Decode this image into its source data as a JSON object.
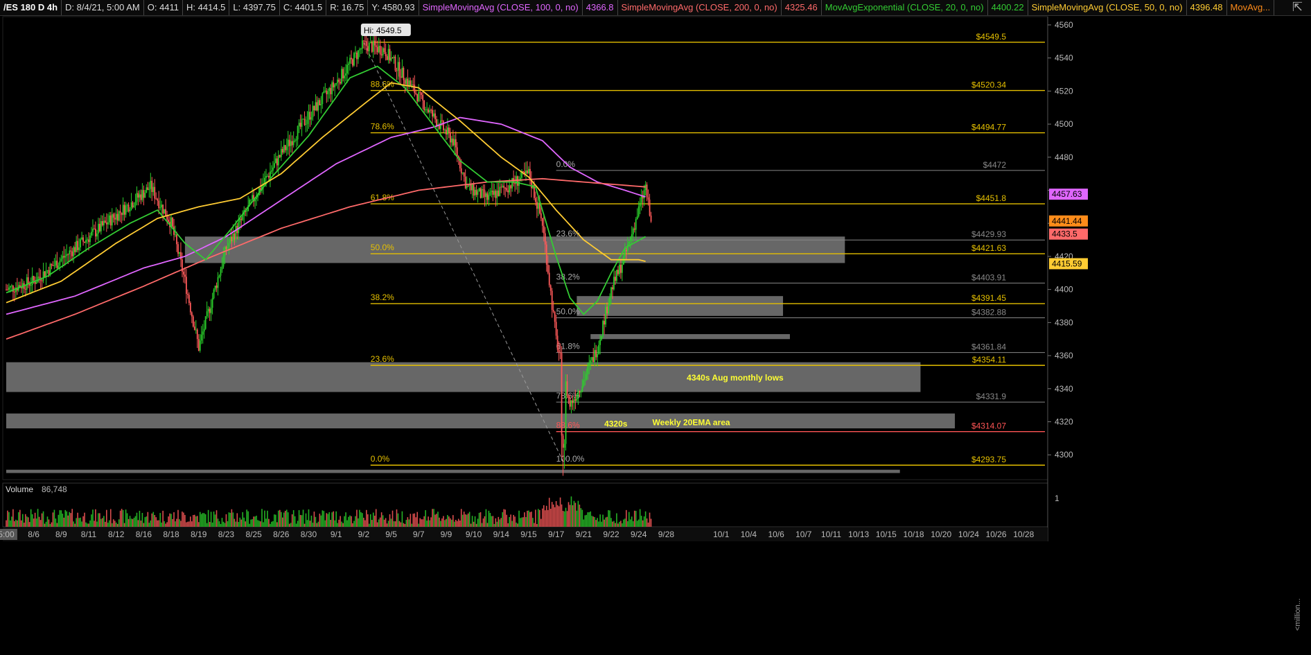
{
  "header": {
    "symbol": "/ES 180 D 4h",
    "date": "D: 8/4/21, 5:00 AM",
    "open": "O: 4411",
    "high": "H: 4414.5",
    "low": "L: 4397.75",
    "close": "C: 4401.5",
    "range": "R: 16.75",
    "y": "Y: 4580.93",
    "studies": [
      {
        "label": "SimpleMovingAvg (CLOSE, 100, 0, no)",
        "value": "4366.8",
        "color": "#e066ff"
      },
      {
        "label": "SimpleMovingAvg (CLOSE, 200, 0, no)",
        "value": "4325.46",
        "color": "#ff6a6a"
      },
      {
        "label": "MovAvgExponential (CLOSE, 20, 0, no)",
        "value": "4400.22",
        "color": "#33cc33"
      },
      {
        "label": "SimpleMovingAvg (CLOSE, 50, 0, no)",
        "value": "4396.48",
        "color": "#ffcc33"
      },
      {
        "label": "MovAvg...",
        "value": "",
        "color": "#ff8c1a"
      }
    ]
  },
  "chart_data": {
    "type": "line",
    "title": "/ES 180 D 4h",
    "ylim": [
      4285,
      4565
    ],
    "yticks": [
      4300,
      4320,
      4340,
      4360,
      4380,
      4400,
      4420,
      4440,
      4460,
      4480,
      4500,
      4520,
      4540,
      4560
    ],
    "ytick_labels": [
      "4300",
      "4320",
      "4340",
      "4360",
      "4380",
      "4400",
      "4420",
      "",
      "",
      "4480",
      "4500",
      "4520",
      "4540",
      "4560"
    ],
    "xlabels": [
      "5:00",
      "8/6",
      "8/9",
      "8/11",
      "8/12",
      "8/16",
      "8/18",
      "8/19",
      "8/23",
      "8/25",
      "8/26",
      "8/30",
      "9/1",
      "9/2",
      "9/5",
      "9/7",
      "9/9",
      "9/10",
      "9/14",
      "9/15",
      "9/17",
      "9/21",
      "9/22",
      "9/24",
      "9/28",
      "10/1",
      "10/4",
      "10/6",
      "10/7",
      "10/11",
      "10/13",
      "10/15",
      "10/18",
      "10/20",
      "10/24",
      "10/26",
      "10/28"
    ],
    "xlabel_slots": [
      0,
      4,
      8,
      12,
      16,
      20,
      24,
      28,
      32,
      36,
      40,
      44,
      48,
      52,
      56,
      60,
      64,
      68,
      72,
      76,
      80,
      84,
      88,
      92,
      96,
      104,
      108,
      112,
      116,
      120,
      124,
      128,
      132,
      136,
      140,
      144,
      148
    ],
    "slot_count": 152,
    "price_key_points": [
      [
        0,
        4400
      ],
      [
        4,
        4405
      ],
      [
        10,
        4425
      ],
      [
        16,
        4445
      ],
      [
        21,
        4462
      ],
      [
        24,
        4440
      ],
      [
        26,
        4405
      ],
      [
        28,
        4365
      ],
      [
        30,
        4395
      ],
      [
        32,
        4425
      ],
      [
        36,
        4455
      ],
      [
        40,
        4482
      ],
      [
        44,
        4505
      ],
      [
        48,
        4525
      ],
      [
        52,
        4548
      ],
      [
        55,
        4545
      ],
      [
        58,
        4528
      ],
      [
        62,
        4505
      ],
      [
        65,
        4490
      ],
      [
        67,
        4462
      ],
      [
        70,
        4455
      ],
      [
        74,
        4465
      ],
      [
        76,
        4470
      ],
      [
        78,
        4440
      ],
      [
        80,
        4370
      ],
      [
        82,
        4330
      ],
      [
        84,
        4345
      ],
      [
        86,
        4365
      ],
      [
        88,
        4400
      ],
      [
        90,
        4420
      ],
      [
        92,
        4448
      ],
      [
        93,
        4462
      ],
      [
        94,
        4434
      ]
    ],
    "price_low": {
      "slot": 81,
      "value": 4296
    },
    "high_label": "Hi: 4549.5",
    "ma_series": [
      {
        "name": "SimpleMovingAvg (CLOSE, 100, 0, no)",
        "color": "#e066ff",
        "points": [
          [
            0,
            4385
          ],
          [
            10,
            4396
          ],
          [
            20,
            4413
          ],
          [
            26,
            4420
          ],
          [
            32,
            4432
          ],
          [
            40,
            4454
          ],
          [
            48,
            4476
          ],
          [
            56,
            4492
          ],
          [
            62,
            4498
          ],
          [
            66,
            4504
          ],
          [
            72,
            4500
          ],
          [
            78,
            4490
          ],
          [
            82,
            4474
          ],
          [
            86,
            4465
          ],
          [
            90,
            4460
          ],
          [
            93,
            4456
          ]
        ]
      },
      {
        "name": "SimpleMovingAvg (CLOSE, 200, 0, no)",
        "color": "#ff6a6a",
        "points": [
          [
            0,
            4370
          ],
          [
            10,
            4385
          ],
          [
            20,
            4402
          ],
          [
            30,
            4420
          ],
          [
            40,
            4437
          ],
          [
            50,
            4450
          ],
          [
            60,
            4460
          ],
          [
            70,
            4465
          ],
          [
            78,
            4467
          ],
          [
            84,
            4465
          ],
          [
            90,
            4463
          ],
          [
            93,
            4462
          ]
        ]
      },
      {
        "name": "MovAvgExponential (CLOSE, 20, 0, no)",
        "color": "#33cc33",
        "points": [
          [
            0,
            4398
          ],
          [
            6,
            4408
          ],
          [
            12,
            4425
          ],
          [
            18,
            4440
          ],
          [
            22,
            4448
          ],
          [
            26,
            4428
          ],
          [
            29,
            4418
          ],
          [
            33,
            4438
          ],
          [
            38,
            4465
          ],
          [
            44,
            4493
          ],
          [
            50,
            4528
          ],
          [
            54,
            4535
          ],
          [
            58,
            4522
          ],
          [
            62,
            4500
          ],
          [
            66,
            4478
          ],
          [
            70,
            4465
          ],
          [
            74,
            4465
          ],
          [
            77,
            4462
          ],
          [
            80,
            4420
          ],
          [
            82,
            4395
          ],
          [
            84,
            4385
          ],
          [
            86,
            4393
          ],
          [
            88,
            4410
          ],
          [
            90,
            4425
          ],
          [
            93,
            4432
          ]
        ]
      },
      {
        "name": "SimpleMovingAvg (CLOSE, 50, 0, no)",
        "color": "#ffcc33",
        "points": [
          [
            0,
            4392
          ],
          [
            8,
            4405
          ],
          [
            16,
            4428
          ],
          [
            22,
            4443
          ],
          [
            28,
            4450
          ],
          [
            34,
            4455
          ],
          [
            40,
            4470
          ],
          [
            46,
            4492
          ],
          [
            52,
            4512
          ],
          [
            56,
            4525
          ],
          [
            60,
            4522
          ],
          [
            66,
            4502
          ],
          [
            72,
            4480
          ],
          [
            76,
            4468
          ],
          [
            80,
            4448
          ],
          [
            84,
            4430
          ],
          [
            88,
            4418
          ],
          [
            92,
            4418
          ],
          [
            93,
            4417
          ]
        ]
      }
    ],
    "levels": [
      {
        "value": 4549.5,
        "label": "$4549.5",
        "color": "#e6c000"
      },
      {
        "value": 4520.34,
        "label": "$4520.34",
        "color": "#e6c000"
      },
      {
        "value": 4494.77,
        "label": "$4494.77",
        "color": "#e6c000"
      },
      {
        "value": 4472,
        "label": "$4472",
        "color": "#888888"
      },
      {
        "value": 4451.8,
        "label": "$4451.8",
        "color": "#e6c000"
      },
      {
        "value": 4429.93,
        "label": "$4429.93",
        "color": "#888888"
      },
      {
        "value": 4421.63,
        "label": "$4421.63",
        "color": "#e6c000"
      },
      {
        "value": 4403.91,
        "label": "$4403.91",
        "color": "#888888"
      },
      {
        "value": 4391.45,
        "label": "$4391.45",
        "color": "#e6c000"
      },
      {
        "value": 4382.88,
        "label": "$4382.88",
        "color": "#888888"
      },
      {
        "value": 4361.84,
        "label": "$4361.84",
        "color": "#888888"
      },
      {
        "value": 4354.11,
        "label": "$4354.11",
        "color": "#e6c000"
      },
      {
        "value": 4331.9,
        "label": "$4331.9",
        "color": "#888888"
      },
      {
        "value": 4314.07,
        "label": "$4314.07",
        "color": "#ff5555"
      },
      {
        "value": 4293.75,
        "label": "$4293.75",
        "color": "#e6c000"
      }
    ],
    "fib_labels": [
      {
        "text": "88.6%",
        "value": 4520.34,
        "slot": 53,
        "color": "#e6c000"
      },
      {
        "text": "78.6%",
        "value": 4494.77,
        "slot": 53,
        "color": "#e6c000"
      },
      {
        "text": "61.8%",
        "value": 4451.8,
        "slot": 53,
        "color": "#e6c000"
      },
      {
        "text": "50.0%",
        "value": 4421.63,
        "slot": 53,
        "color": "#e6c000"
      },
      {
        "text": "38.2%",
        "value": 4391.45,
        "slot": 53,
        "color": "#e6c000"
      },
      {
        "text": "23.6%",
        "value": 4354.11,
        "slot": 53,
        "color": "#e6c000"
      },
      {
        "text": "0.0%",
        "value": 4293.75,
        "slot": 53,
        "color": "#e6c000"
      },
      {
        "text": "0.0%",
        "value": 4472,
        "slot": 80,
        "color": "#aaaaaa"
      },
      {
        "text": "23.6%",
        "value": 4429.93,
        "slot": 80,
        "color": "#aaaaaa"
      },
      {
        "text": "38.2%",
        "value": 4403.91,
        "slot": 80,
        "color": "#aaaaaa"
      },
      {
        "text": "50.0%",
        "value": 4382.88,
        "slot": 80,
        "color": "#aaaaaa"
      },
      {
        "text": "61.8%",
        "value": 4361.84,
        "slot": 80,
        "color": "#aaaaaa"
      },
      {
        "text": "78.6%",
        "value": 4331.9,
        "slot": 80,
        "color": "#aaaaaa"
      },
      {
        "text": "88.6%",
        "value": 4314.07,
        "slot": 80,
        "color": "#ff5555"
      },
      {
        "text": "100.0%",
        "value": 4293.75,
        "slot": 80,
        "color": "#aaaaaa"
      }
    ],
    "zones": [
      {
        "from": 4416,
        "to": 4432,
        "start_slot": 26,
        "end_slot": 122
      },
      {
        "from": 4384,
        "to": 4396,
        "start_slot": 83,
        "end_slot": 113
      },
      {
        "from": 4370,
        "to": 4373,
        "start_slot": 85,
        "end_slot": 114
      },
      {
        "from": 4338,
        "to": 4356,
        "start_slot": 0,
        "end_slot": 133
      },
      {
        "from": 4316,
        "to": 4325,
        "start_slot": 0,
        "end_slot": 138
      },
      {
        "from": 4289,
        "to": 4291,
        "start_slot": 0,
        "end_slot": 130
      }
    ],
    "annotations": [
      {
        "text": "4340s Aug monthly lows",
        "value": 4345,
        "slot": 99,
        "color": "#ffff33"
      },
      {
        "text": "Weekly 20EMA area",
        "value": 4318,
        "slot": 94,
        "color": "#ffff33"
      },
      {
        "text": "4320s",
        "value": 4317,
        "slot": 87,
        "color": "#ffff33"
      }
    ],
    "price_badges": [
      {
        "text": "4457.63",
        "value": 4457.63,
        "color": "#e066ff",
        "text_color": "#000000"
      },
      {
        "text": "4441.44",
        "value": 4441.44,
        "color": "#ff8c1a",
        "text_color": "#000000"
      },
      {
        "text": "4433.5",
        "value": 4433.5,
        "color": "#ff6a6a",
        "text_color": "#000000"
      },
      {
        "text": "4415.59",
        "value": 4415.59,
        "color": "#ffcc33",
        "text_color": "#000000"
      }
    ],
    "volume": {
      "label": "Volume",
      "value": "86,748",
      "ymax_label": "1",
      "unit_label": "<million..."
    }
  }
}
